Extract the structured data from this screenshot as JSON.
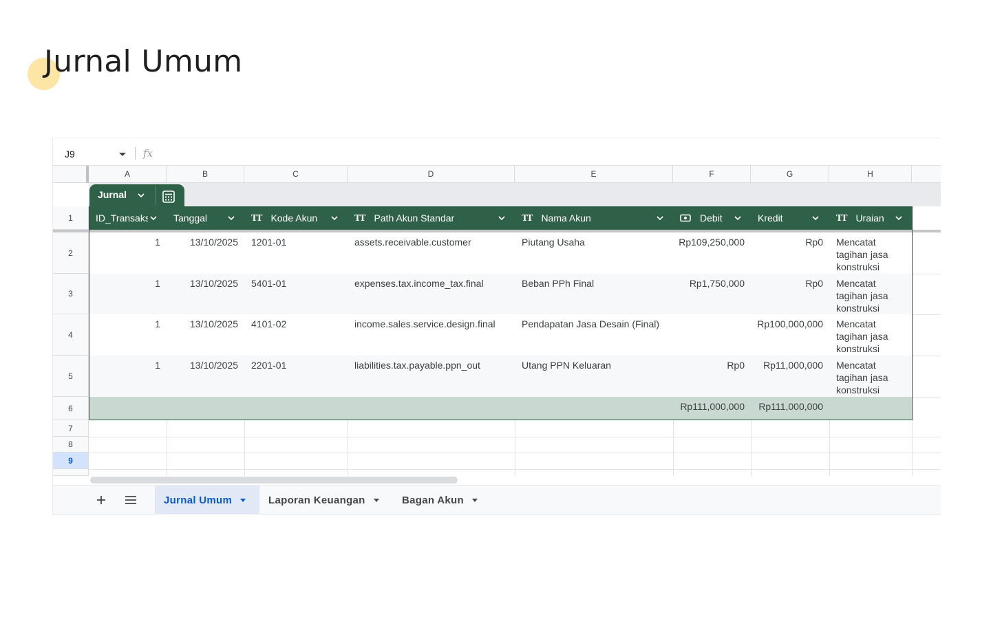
{
  "page": {
    "title": "Jurnal Umum"
  },
  "formula_bar": {
    "cell_ref": "J9",
    "fx_label": "fx",
    "value": ""
  },
  "columns": [
    "A",
    "B",
    "C",
    "D",
    "E",
    "F",
    "G",
    "H"
  ],
  "rows": [
    "1",
    "2",
    "3",
    "4",
    "5",
    "6",
    "7",
    "8",
    "9"
  ],
  "table": {
    "name": "Jurnal",
    "headers": [
      {
        "label": "ID_Transaksi",
        "type_icon": "none"
      },
      {
        "label": "Tanggal",
        "type_icon": "none"
      },
      {
        "label": "Kode Akun",
        "type_icon": "text-type-icon"
      },
      {
        "label": "Path Akun Standar",
        "type_icon": "text-type-icon"
      },
      {
        "label": "Nama Akun",
        "type_icon": "text-type-icon"
      },
      {
        "label": "Debit",
        "type_icon": "currency-type-icon"
      },
      {
        "label": "Kredit",
        "type_icon": "none"
      },
      {
        "label": "Uraian",
        "type_icon": "text-type-icon"
      }
    ],
    "rows": [
      {
        "id": "1",
        "tanggal": "13/10/2025",
        "kode": "1201-01",
        "path": "assets.receivable.customer",
        "nama": "Piutang Usaha",
        "debit": "Rp109,250,000",
        "kredit": "Rp0",
        "uraian": "Mencatat tagihan jasa konstruksi"
      },
      {
        "id": "1",
        "tanggal": "13/10/2025",
        "kode": "5401-01",
        "path": "expenses.tax.income_tax.final",
        "nama": "Beban PPh Final",
        "debit": "Rp1,750,000",
        "kredit": "Rp0",
        "uraian": "Mencatat tagihan jasa konstruksi"
      },
      {
        "id": "1",
        "tanggal": "13/10/2025",
        "kode": "4101-02",
        "path": "income.sales.service.design.final",
        "nama": "Pendapatan Jasa Desain (Final)",
        "debit": "",
        "kredit": "Rp100,000,000",
        "uraian": "Mencatat tagihan jasa konstruksi"
      },
      {
        "id": "1",
        "tanggal": "13/10/2025",
        "kode": "2201-01",
        "path": "liabilities.tax.payable.ppn_out",
        "nama": "Utang PPN Keluaran",
        "debit": "Rp0",
        "kredit": "Rp11,000,000",
        "uraian": "Mencatat tagihan jasa konstruksi"
      }
    ],
    "totals": {
      "debit": "Rp111,000,000",
      "kredit": "Rp111,000,000"
    }
  },
  "sheet_tabs": [
    {
      "label": "Jurnal Umum",
      "active": true
    },
    {
      "label": "Laporan Keuangan",
      "active": false
    },
    {
      "label": "Bagan Akun",
      "active": false
    }
  ],
  "colors": {
    "table_header": "#2e6147",
    "total_row": "#c9d8d0",
    "active_tab": "#0b57d0",
    "title_dot": "#fde5a6"
  }
}
